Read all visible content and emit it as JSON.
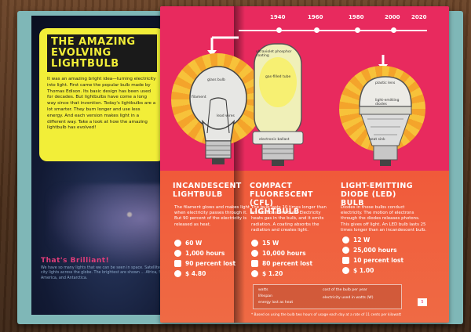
{
  "left_page": {
    "title": "The Amazing Evolving Lightbulb",
    "intro": "It was an amazing bright idea—turning electricity into light. First came the popular bulb made by Thomas Edison. Its basic design has been used for decades. But lightbulbs have come a long way since that invention. Today's lightbulbs are a lot smarter. They burn longer and use less energy. And each version makes light in a different way. Take a look at how the amazing lightbulb has evolved!",
    "brilliant_title": "That's Brilliant!",
    "brilliant_text": "We have so many lights that we can be seen in space. Satellite photos show city lights across the globe. The brightest are shown ... Africa, Southern America, and Antarctica."
  },
  "timeline": {
    "years": [
      "1940",
      "1960",
      "1980",
      "2000",
      "2020"
    ]
  },
  "bulbs": [
    {
      "title": "Incandescent Lightbulb",
      "description": "The filament glows and makes light when electricity passes through it. But 90 percent of the electricity is released as heat.",
      "parts": [
        "glass bulb",
        "filament",
        "lead wires"
      ],
      "stats": {
        "power": "60 W",
        "life": "1,000 hours",
        "lost": "90 percent lost",
        "cost": "$ 4.80"
      }
    },
    {
      "title": "Compact Fluorescent (CFL) Lightbulb",
      "description": "The bulb lasts 10 times longer than an incandescent bulb! Electricity heats gas in the bulb, and it emits radiation. A coating absorbs the radiation and creates light.",
      "parts": [
        "ultraviolet phosphor coating",
        "gas-filled tube",
        "electronic ballast"
      ],
      "stats": {
        "power": "15 W",
        "life": "10,000 hours",
        "lost": "80 percent lost",
        "cost": "$ 1.20"
      }
    },
    {
      "title": "Light-Emitting Diode (LED) Bulb",
      "description": "Diodes in these bulbs conduct electricity. The motion of electrons through the diodes releases photons. This gives off light. An LED bulb lasts 25 times longer than an incandescent bulb.",
      "parts": [
        "plastic lens",
        "light-emitting diodes",
        "heat sink"
      ],
      "stats": {
        "power": "12 W",
        "life": "25,000 hours",
        "lost": "10 percent lost",
        "cost": "$ 1.00"
      }
    }
  ],
  "legend": {
    "items": [
      "watts",
      "lifespan",
      "cost of the bulb per year",
      "energy lost as heat",
      "electricity used in watts (W)"
    ]
  },
  "footnote": "* Based on using the bulb two hours of usage each day at a rate of 11 cents per kilowatt",
  "page_number": "5",
  "colors": {
    "pink": "#e82a5e",
    "orange": "#f05a3a",
    "yellow": "#f2ee38",
    "burst": "#f7c23a"
  }
}
